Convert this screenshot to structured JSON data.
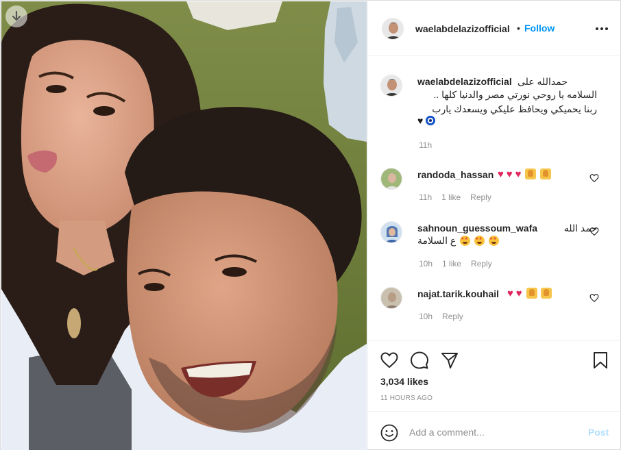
{
  "post": {
    "download_icon": "arrow-down-icon",
    "author": "waelabdelazizofficial",
    "separator": "•",
    "follow_label": "Follow",
    "more_icon": "more-horizontal-icon"
  },
  "caption": {
    "user": "waelabdelazizofficial",
    "line1": "حمدالله على",
    "line2": "السلامه يا روحي نورتي مصر والدنيا كلها ..",
    "line3": "ربنا يحميكي ويحافظ عليكي ويسعدك يارب",
    "line4_emoji": [
      "black-heart",
      "nazar-amulet"
    ],
    "line4_text": "🖤",
    "time": "11h"
  },
  "comments": [
    {
      "user": "randoda_hassan",
      "text": "",
      "emojis": [
        "red-heart",
        "red-heart",
        "red-heart",
        "raising-hands",
        "raising-hands"
      ],
      "time": "11h",
      "likes": "1 like",
      "reply": "Reply"
    },
    {
      "user": "sahnoun_guessoum_wafa",
      "text": "حمد الله",
      "text2": "ع السلامة",
      "emojis": [
        "star-struck",
        "star-struck",
        "star-struck"
      ],
      "time": "10h",
      "likes": "1 like",
      "reply": "Reply"
    },
    {
      "user": "najat.tarik.kouhail",
      "text": "",
      "emojis": [
        "red-heart",
        "red-heart",
        "raising-hands",
        "raising-hands"
      ],
      "time": "10h",
      "likes": "",
      "reply": "Reply"
    }
  ],
  "actions": {
    "like_icon": "heart-icon",
    "comment_icon": "comment-icon",
    "share_icon": "paper-plane-icon",
    "save_icon": "bookmark-icon",
    "likes_count": "3,034 likes",
    "timestamp": "11 HOURS AGO"
  },
  "add_comment": {
    "emoji_icon": "smiley-icon",
    "placeholder": "Add a comment...",
    "post_label": "Post"
  },
  "colors": {
    "link_blue": "#0095f6",
    "post_disabled": "#b2dffc",
    "meta_grey": "#8e8e8e",
    "heart_red": "#e0245e"
  }
}
